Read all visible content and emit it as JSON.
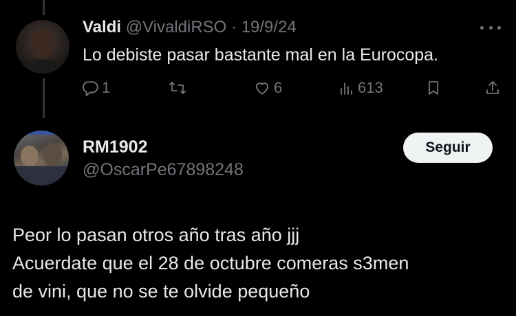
{
  "reply": {
    "name": "Valdi",
    "handle": "@VivaldiRSO",
    "separator": "·",
    "date": "19/9/24",
    "text": "Lo debiste pasar bastante mal en la Eurocopa.",
    "replies": "1",
    "retweets": "",
    "likes": "6",
    "views": "613"
  },
  "tweet": {
    "name": "RM1902",
    "handle": "@OscarPe67898248",
    "follow_label": "Seguir",
    "lines": [
      "Peor lo pasan otros año tras año jjj",
      "Acuerdate que el 28 de octubre comeras s3men",
      "de vini, que no se te olvide pequeño"
    ]
  },
  "icons": {
    "more": "more-icon",
    "reply": "reply-icon",
    "retweet": "retweet-icon",
    "like": "heart-icon",
    "views": "views-icon",
    "bookmark": "bookmark-icon",
    "share": "share-icon"
  },
  "colors": {
    "background": "#000000",
    "text": "#e7e9ea",
    "secondary": "#71767b",
    "button_bg": "#eff3f4",
    "button_text": "#0f1419"
  }
}
